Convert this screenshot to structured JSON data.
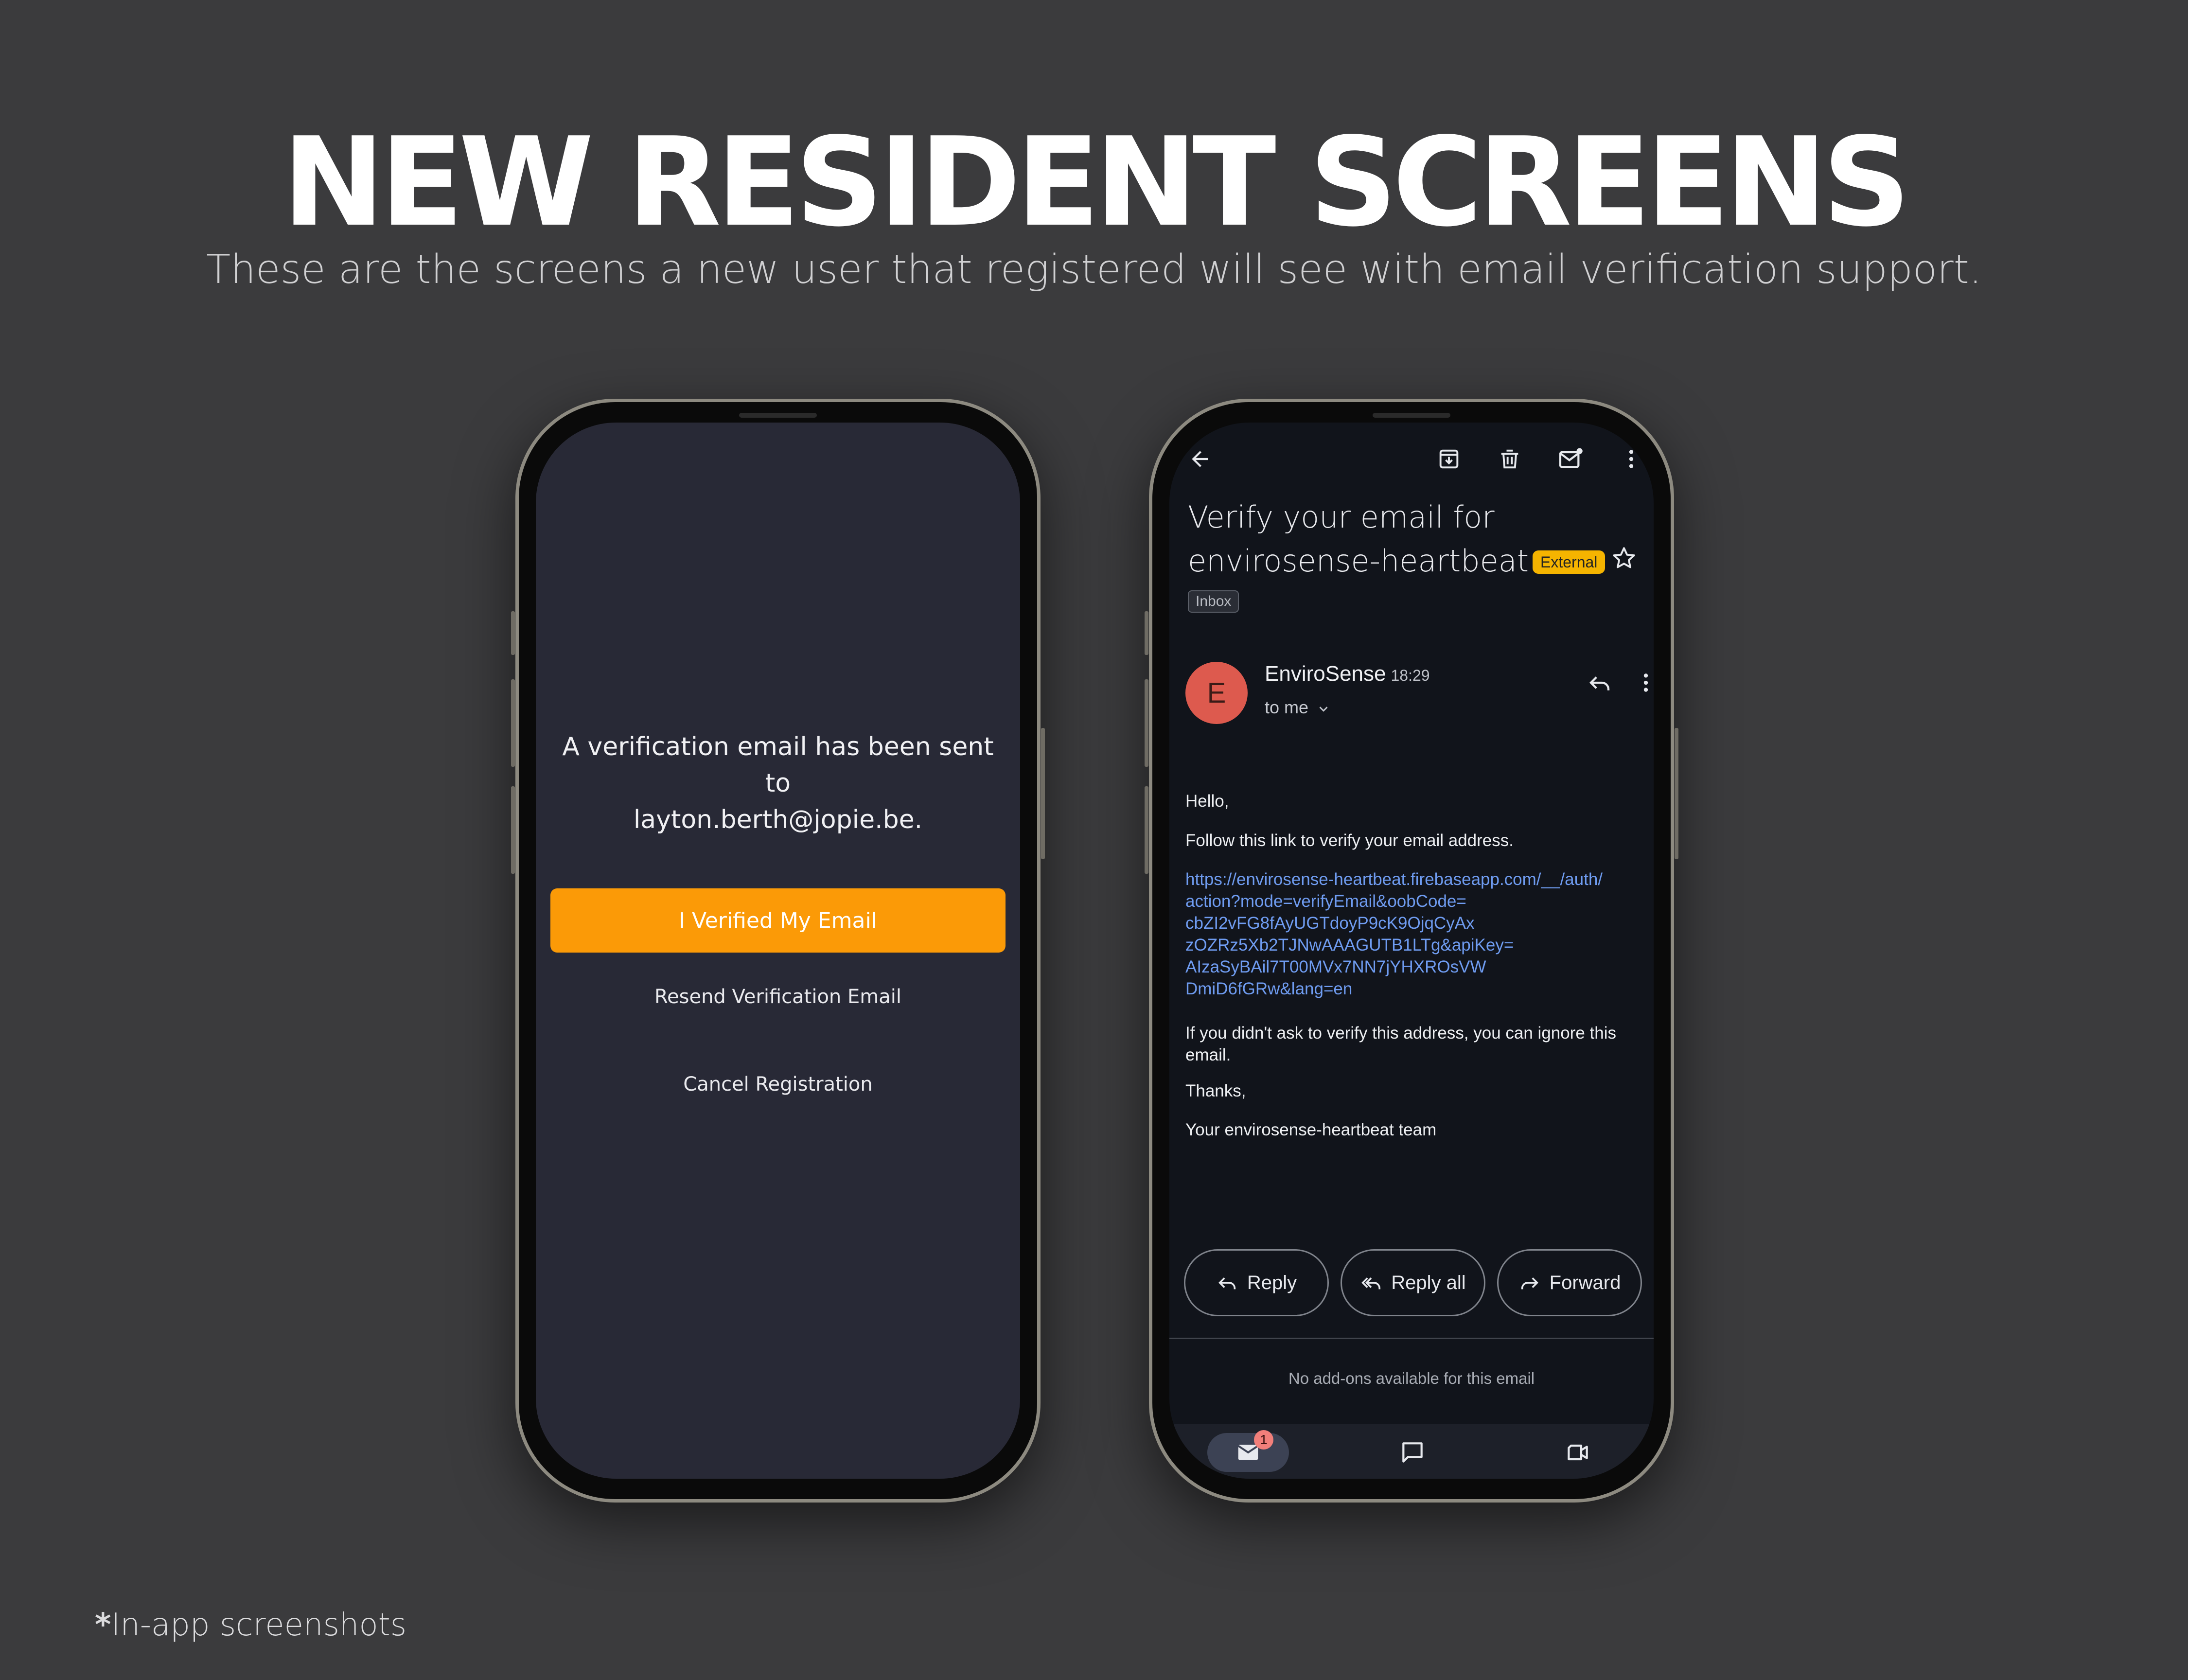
{
  "header": {
    "title": "NEW RESIDENT SCREENS",
    "subtitle": "These are the screens a new user that registered will see with email verification support."
  },
  "footnote": {
    "asterisk": "*",
    "text": "In-app screenshots"
  },
  "app_screen": {
    "message_line1": "A verification email has been sent to",
    "message_line2": "layton.berth@jopie.be.",
    "verify_button": "I Verified My Email",
    "resend_button": "Resend Verification Email",
    "cancel_button": "Cancel Registration",
    "accent_color": "#fb9a07"
  },
  "email_screen": {
    "toolbar": {
      "back_icon": "arrow-left-icon",
      "archive_icon": "archive-icon",
      "delete_icon": "trash-icon",
      "mark_unread_icon": "mark-unread-icon",
      "more_icon": "more-vert-icon"
    },
    "subject_line1": "Verify your email for",
    "subject_line2": "envirosense-heartbeat",
    "external_badge": "External",
    "label": "Inbox",
    "sender": {
      "avatar_letter": "E",
      "name": "EnviroSense",
      "time": "18:29",
      "recipient": "to me"
    },
    "body": {
      "greeting": "Hello,",
      "instruction": "Follow this link to verify your email address.",
      "link_lines": [
        "https://envirosense-heartbeat.firebaseapp.com/__/auth/",
        "action?mode=verifyEmail&oobCode=",
        "cbZI2vFG8fAyUGTdoyP9cK9OjqCyAx",
        "zOZRz5Xb2TJNwAAAGUTB1LTg&apiKey=",
        "AIzaSyBAil7T00MVx7NN7jYHXROsVW",
        "DmiD6fGRw&lang=en"
      ],
      "ignore_note": "If you didn't ask to verify this address, you can ignore this email.",
      "thanks": "Thanks,",
      "signature": "Your envirosense-heartbeat team"
    },
    "actions": {
      "reply": "Reply",
      "reply_all": "Reply all",
      "forward": "Forward"
    },
    "addons_note": "No add-ons available for this email",
    "bottom_nav": {
      "mail_badge": "1"
    },
    "colors": {
      "avatar": "#dd5a4e",
      "badge": "#f5b400",
      "link": "#6f9cf1"
    }
  }
}
